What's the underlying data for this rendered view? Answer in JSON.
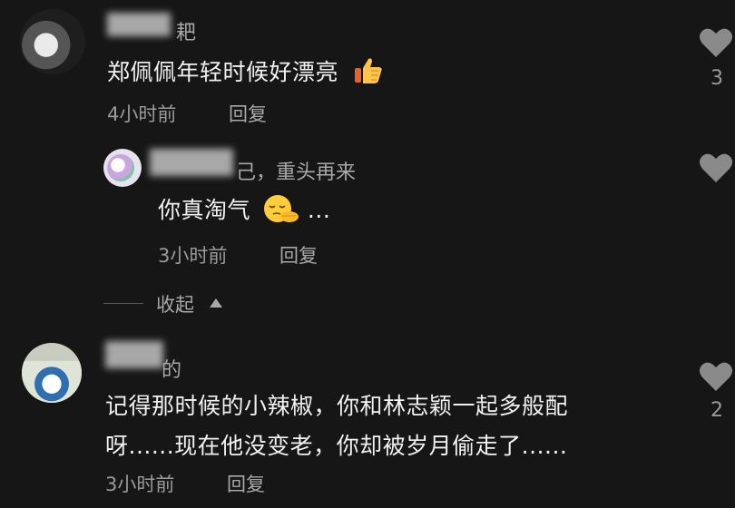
{
  "comments": [
    {
      "username": "耙",
      "text": "郑佩佩年轻时候好漂亮",
      "time": "4小时前",
      "reply": "回复",
      "likes": "3",
      "emoji": "thumbs-up"
    },
    {
      "username": "己，重头再来",
      "text": "你真淘气",
      "text_suffix": "...",
      "time": "3小时前",
      "reply": "回复",
      "likes": "",
      "emoji": "sleepy-face"
    },
    {
      "username": "的",
      "text_line1": "记得那时候的小辣椒，你和林志颖一起多般配",
      "text_line2": "呀......现在他没变老，你却被岁月偷走了......",
      "time": "3小时前",
      "reply": "回复",
      "likes": "2"
    }
  ],
  "collapse": {
    "label": "收起"
  },
  "colors": {
    "background": "#161616",
    "text": "#f1f1f1",
    "muted": "#9a9a9a",
    "heart": "#8a8a8a"
  },
  "icons": [
    "heart-icon",
    "triangle-up-icon",
    "thumbs-up-emoji",
    "sleepy-face-emoji"
  ]
}
